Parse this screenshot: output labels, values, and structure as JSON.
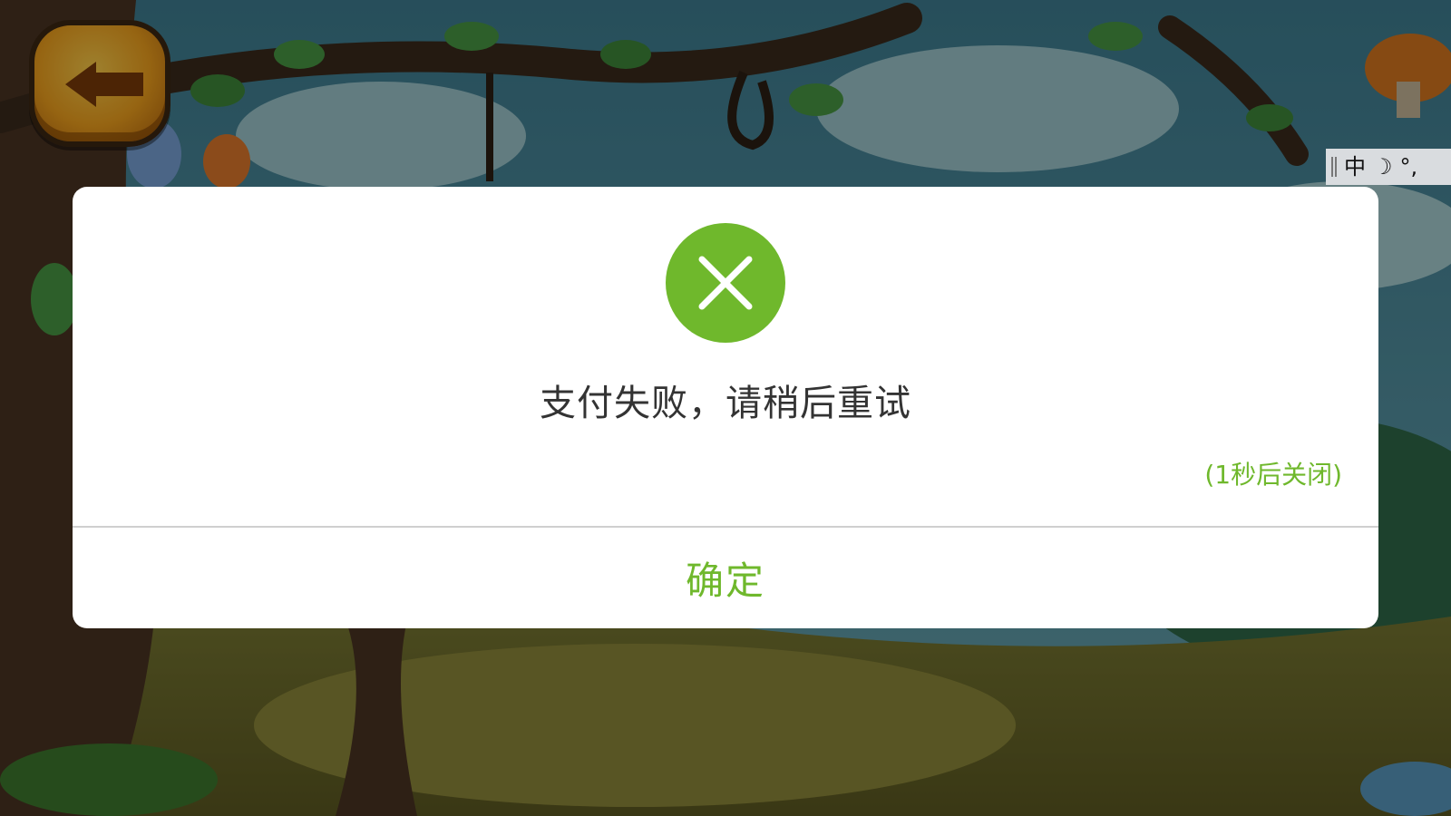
{
  "ime_toolbar": {
    "items": [
      "中",
      "☽",
      "°,"
    ]
  },
  "dialog": {
    "status_icon": "close-icon",
    "message": "支付失败，请稍后重试",
    "countdown": "(1秒后关闭)",
    "confirm_label": "确定"
  },
  "colors": {
    "accent": "#6fb82c",
    "message_text": "#333333",
    "dialog_bg": "#ffffff",
    "divider": "#cfcfcf",
    "back_button": "#f2a21d"
  }
}
